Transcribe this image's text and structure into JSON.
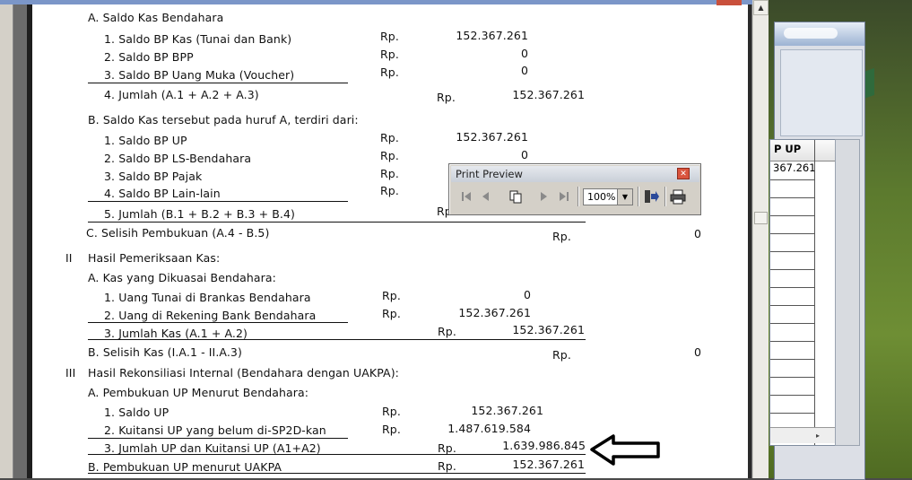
{
  "report": {
    "sections": [
      {
        "text": "A. Saldo Kas Bendahara"
      },
      {
        "text": "1. Saldo BP Kas (Tunai dan Bank)",
        "cur": "Rp.",
        "value": "152.367.261"
      },
      {
        "text": "2. Saldo BP BPP",
        "cur": "Rp.",
        "value": "0"
      },
      {
        "text": "3. Saldo BP Uang Muka (Voucher)",
        "cur": "Rp.",
        "value": "0"
      },
      {
        "text": "4. Jumlah (A.1 + A.2 + A.3)",
        "cur": "Rp.",
        "value": "152.367.261"
      },
      {
        "text": "B. Saldo Kas tersebut pada huruf A, terdiri dari:"
      },
      {
        "text": "1. Saldo BP UP",
        "cur": "Rp.",
        "value": "152.367.261"
      },
      {
        "text": "2. Saldo BP LS-Bendahara",
        "cur": "Rp.",
        "value": "0"
      },
      {
        "text": "3. Saldo BP Pajak",
        "cur": "Rp."
      },
      {
        "text": "4. Saldo BP Lain-lain",
        "cur": "Rp."
      },
      {
        "text": "5. Jumlah (B.1 + B.2 + B.3 + B.4)",
        "cur": "Rp"
      },
      {
        "text": "C. Selisih Pembukuan (A.4 - B.5)",
        "cur": "Rp.",
        "value": "0"
      },
      {
        "num": "II",
        "text": "Hasil Pemeriksaan Kas:"
      },
      {
        "text": "A. Kas yang Dikuasai Bendahara:"
      },
      {
        "text": "1. Uang Tunai di Brankas Bendahara",
        "cur": "Rp.",
        "value": "0"
      },
      {
        "text": "2. Uang di Rekening Bank Bendahara",
        "cur": "Rp.",
        "value": "152.367.261"
      },
      {
        "text": "3. Jumlah Kas  (A.1 + A.2)",
        "cur": "Rp.",
        "value": "152.367.261"
      },
      {
        "text": "B. Selisih Kas (I.A.1 - II.A.3)",
        "cur": "Rp.",
        "value": "0"
      },
      {
        "num": "III",
        "text": "Hasil Rekonsiliasi Internal (Bendahara dengan UAKPA):"
      },
      {
        "text": "A. Pembukuan UP Menurut Bendahara:"
      },
      {
        "text": "1. Saldo UP",
        "cur": "Rp.",
        "value": "152.367.261"
      },
      {
        "text": "2. Kuitansi UP yang belum di-SP2D-kan",
        "cur": "Rp.",
        "value": "1.487.619.584"
      },
      {
        "text": "3. Jumlah UP dan Kuitansi UP (A1+A2)",
        "cur": "Rp.",
        "value": "1.639.986.845"
      },
      {
        "text": "B. Pembukuan UP menurut UAKPA",
        "cur": "Rp.",
        "value": "152.367.261"
      }
    ]
  },
  "print_preview": {
    "title": "Print Preview",
    "zoom": "100%",
    "icons": [
      "first-page-icon",
      "prev-page-icon",
      "multi-page-icon",
      "next-page-icon",
      "last-page-icon",
      "zoom-dropdown-icon",
      "exit-icon",
      "printer-icon"
    ]
  },
  "background_grid": {
    "header": "P UP",
    "first_value": "367.261"
  },
  "colors": {
    "paper": "#ffffff",
    "toolbar": "#d4d0c8",
    "close_red": "#d9543e"
  }
}
